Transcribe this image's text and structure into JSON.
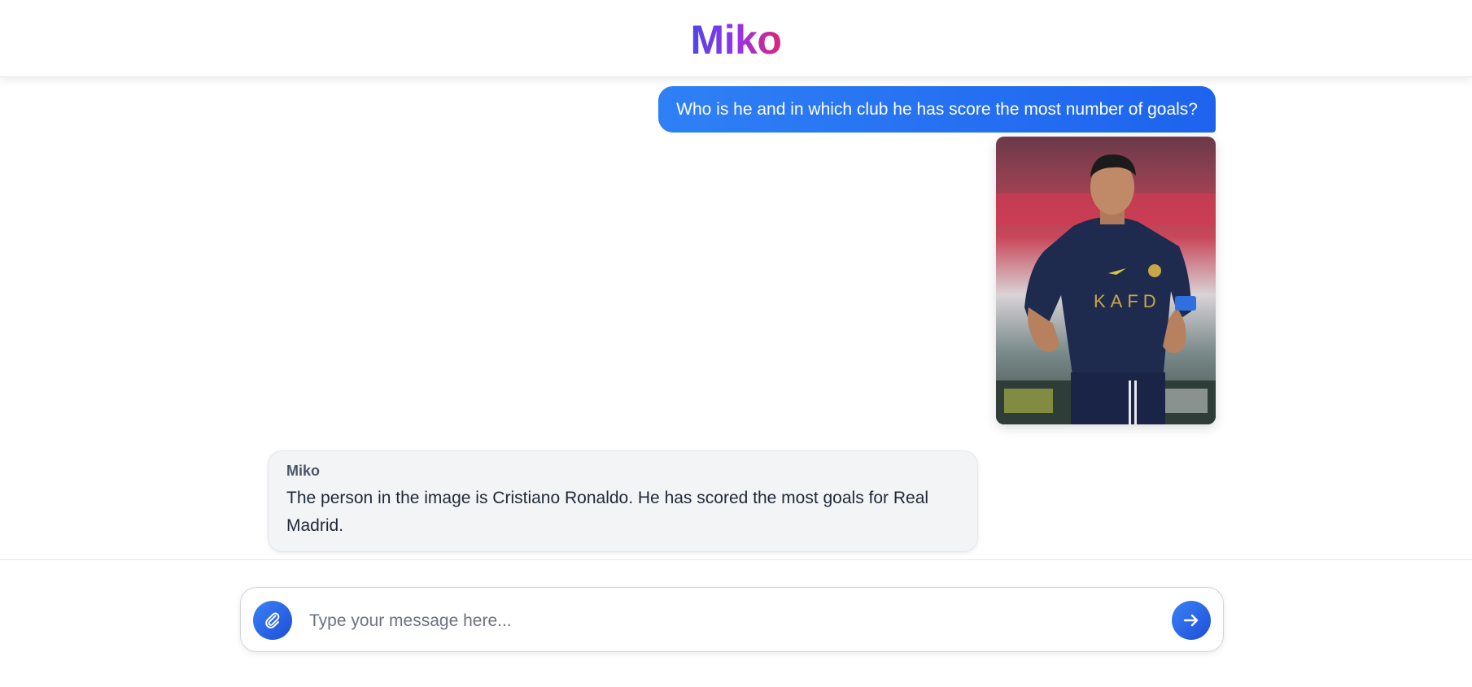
{
  "app": {
    "title": "Miko"
  },
  "messages": {
    "user_text": "Who is he and in which club he has score the most number of goals?",
    "bot_name": "Miko",
    "bot_text": "The person in the image is Cristiano Ronaldo. He has scored the most goals for Real Madrid."
  },
  "composer": {
    "placeholder": "Type your message here...",
    "value": ""
  },
  "icons": {
    "attach": "paperclip-icon",
    "send": "arrow-right-icon"
  },
  "colors": {
    "brand_gradient_start": "#4f46e5",
    "brand_gradient_end": "#db2777",
    "user_bubble": "#2f80f5",
    "accent": "#1d63ee"
  }
}
